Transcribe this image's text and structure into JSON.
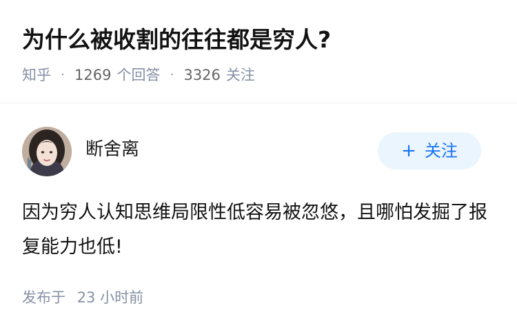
{
  "question": {
    "title": "为什么被收割的往往都是穷人?",
    "source": "知乎",
    "answer_count": "1269",
    "answer_label": "个回答",
    "follower_count": "3326",
    "follower_label": "关注",
    "separator": "·"
  },
  "answer": {
    "author_name": "断舍离",
    "follow_button": {
      "plus": "+",
      "label": "关注"
    },
    "content": "因为穷人认知思维局限性低容易被忽悠，且哪怕发掘了报复能力也低!",
    "time_label": "发布于",
    "time_value": "23 小时前"
  },
  "colors": {
    "text": "#121212",
    "meta": "#8590a6",
    "follow_bg": "#ebf5fd",
    "follow_text": "#1772f6"
  }
}
